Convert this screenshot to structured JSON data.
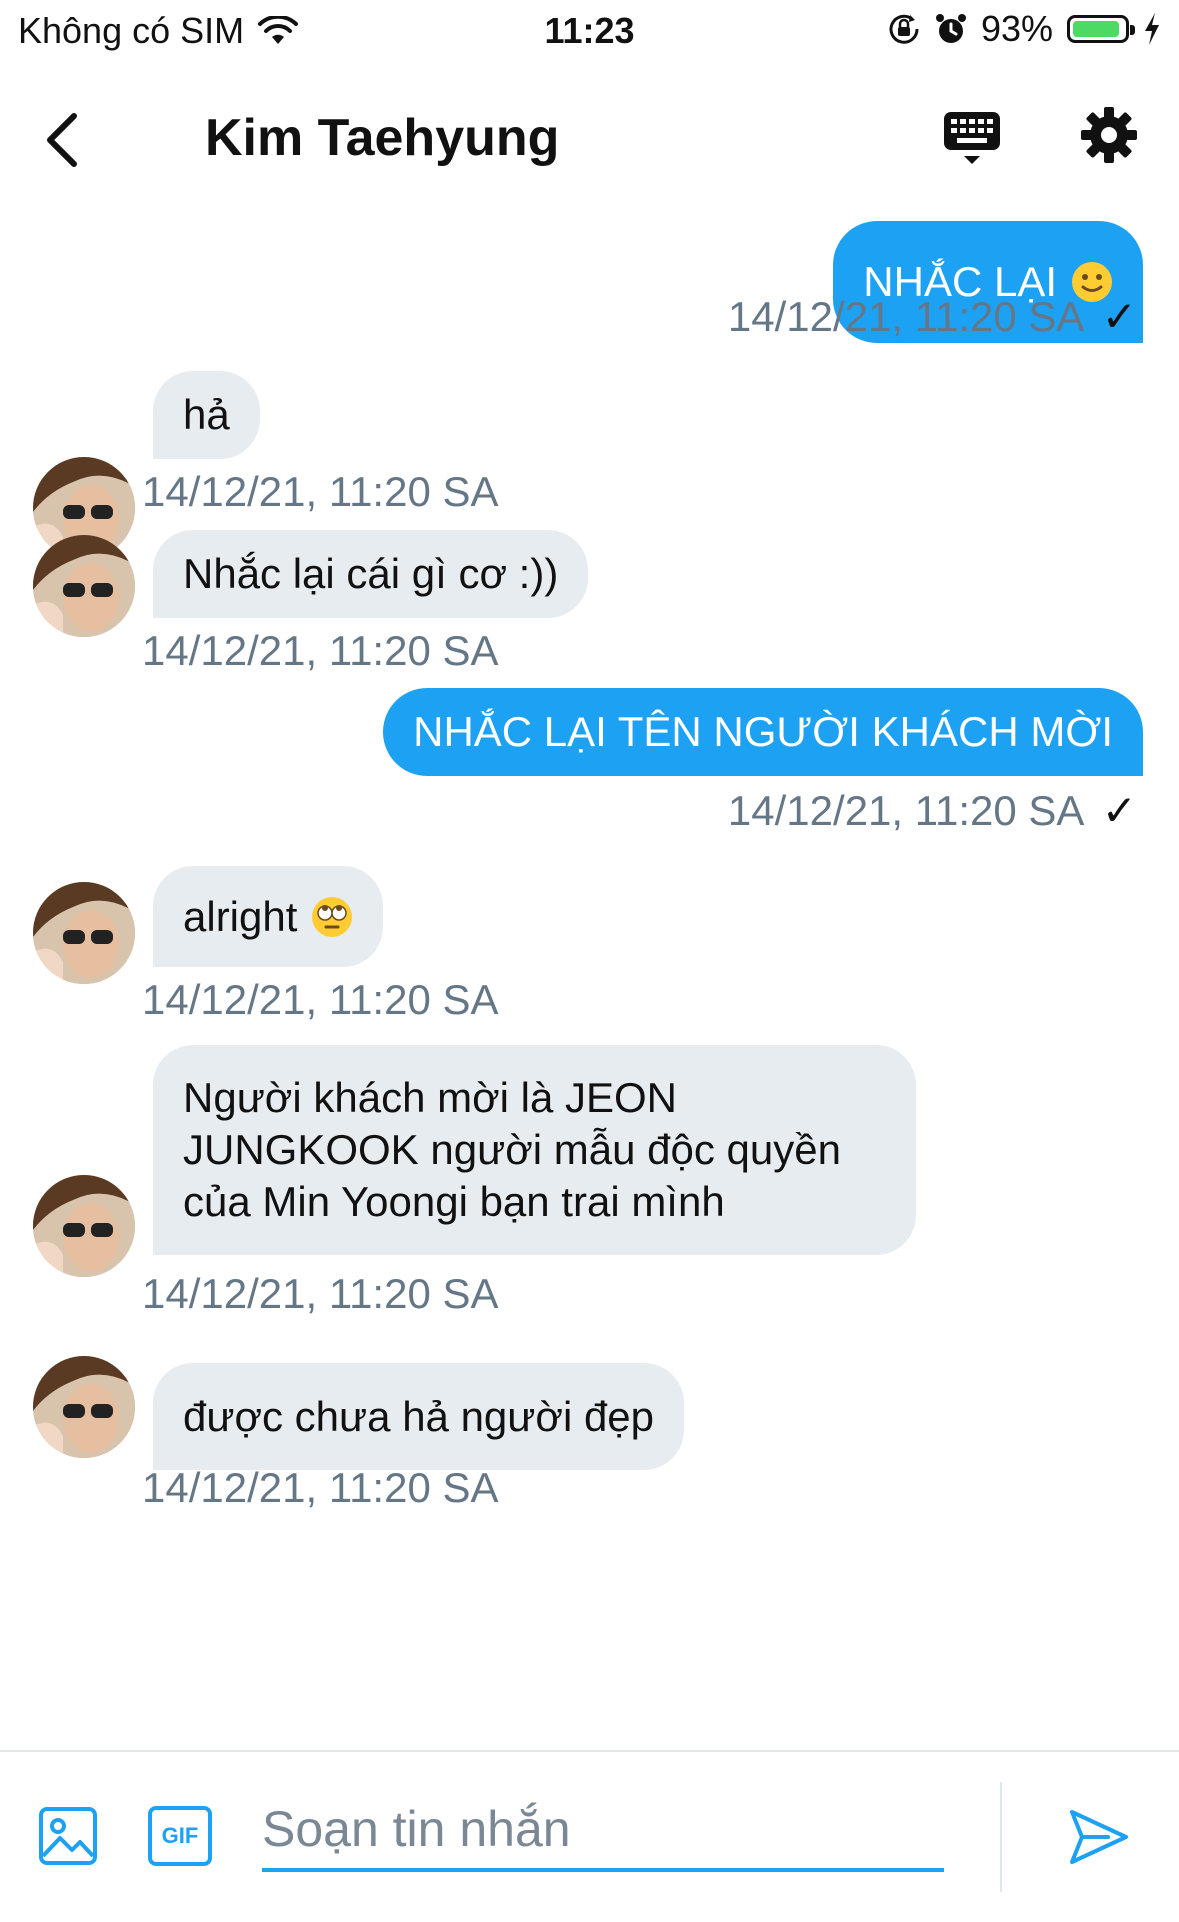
{
  "status_bar": {
    "carrier": "Không có SIM",
    "time": "11:23",
    "battery": "93%",
    "battery_level": 0.93,
    "icons": [
      "wifi-icon",
      "rotation-lock-icon",
      "alarm-icon",
      "battery-icon",
      "charging-icon"
    ]
  },
  "header": {
    "title": "Kim Taehyung",
    "icons": [
      "back-chevron-icon",
      "keyboard-icon",
      "gear-icon"
    ]
  },
  "messages": [
    {
      "dir": "out",
      "text": "NHẮC LẠI",
      "emoji": "slightly-smiling-face",
      "timestamp": "14/12/21, 11:20 SA",
      "read_mark": "✓"
    },
    {
      "dir": "in",
      "text": "hả",
      "timestamp": "14/12/21, 11:20 SA"
    },
    {
      "dir": "in",
      "text": "Nhắc lại cái gì cơ :))",
      "timestamp": "14/12/21, 11:20 SA"
    },
    {
      "dir": "out",
      "text": "NHẮC LẠI TÊN NGƯỜI KHÁCH MỜI",
      "timestamp": "14/12/21, 11:20 SA",
      "read_mark": "✓"
    },
    {
      "dir": "in",
      "text": "alright",
      "emoji": "face-with-rolling-eyes",
      "timestamp": "14/12/21, 11:20 SA"
    },
    {
      "dir": "in",
      "text": "Người khách mời là JEON JUNGKOOK người mẫu độc quyền của Min Yoongi bạn trai mình",
      "timestamp": "14/12/21, 11:20 SA"
    },
    {
      "dir": "in",
      "text": "được chưa hả người đẹp",
      "timestamp": "14/12/21, 11:20 SA"
    }
  ],
  "composer": {
    "placeholder": "Soạn tin nhắn",
    "gif_label": "GIF",
    "icons": [
      "image-icon",
      "gif-icon",
      "send-icon"
    ]
  },
  "colors": {
    "accent": "#1da1f2",
    "incoming_bubble": "#e6ecf0",
    "timestamp": "#657786",
    "battery_fill": "#4cd964"
  }
}
